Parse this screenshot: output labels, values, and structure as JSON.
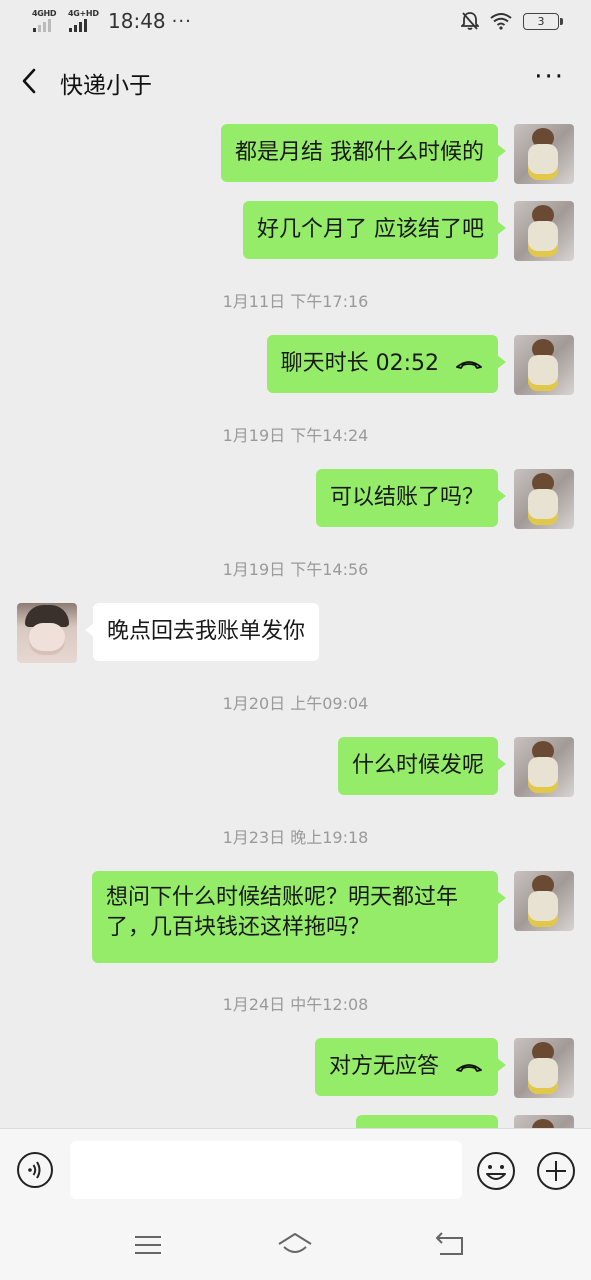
{
  "status_bar": {
    "net1": "4GHD",
    "net2": "4G+HD",
    "time": "18:48",
    "dots": "···",
    "battery": "3",
    "icons": [
      "mute-bell-icon",
      "wifi-icon",
      "battery-icon"
    ]
  },
  "header": {
    "title": "快递小于",
    "more": "···"
  },
  "messages": [
    {
      "side": "me",
      "text": "都是月结 我都什么时候的"
    },
    {
      "side": "me",
      "text": "好几个月了  应该结了吧"
    },
    {
      "time": "1月11日 下午17:16"
    },
    {
      "side": "me",
      "text": "聊天时长 02:52",
      "icon": "phone-hangup-icon"
    },
    {
      "time": "1月19日 下午14:24"
    },
    {
      "side": "me",
      "text": "可以结账了吗？"
    },
    {
      "time": "1月19日 下午14:56"
    },
    {
      "side": "other",
      "text": "晚点回去我账单发你"
    },
    {
      "time": "1月20日 上午09:04"
    },
    {
      "side": "me",
      "text": "什么时候发呢"
    },
    {
      "time": "1月23日 晚上19:18"
    },
    {
      "side": "me",
      "text": "想问下什么时候结账呢？明天都过年了，几百块钱还这样拖吗？"
    },
    {
      "time": "1月24日 中午12:08"
    },
    {
      "side": "me",
      "text": "对方无应答",
      "icon": "phone-hangup-icon"
    }
  ],
  "input_bar": {
    "placeholder": "",
    "icons": [
      "voice-icon",
      "emoji-icon",
      "plus-icon"
    ]
  },
  "system_nav": {
    "icons": [
      "menu-icon",
      "home-icon",
      "back-icon"
    ]
  },
  "colors": {
    "background": "#ededed",
    "my_bubble": "#95ec69",
    "other_bubble": "#ffffff",
    "timestamp": "#9a9a9a"
  }
}
